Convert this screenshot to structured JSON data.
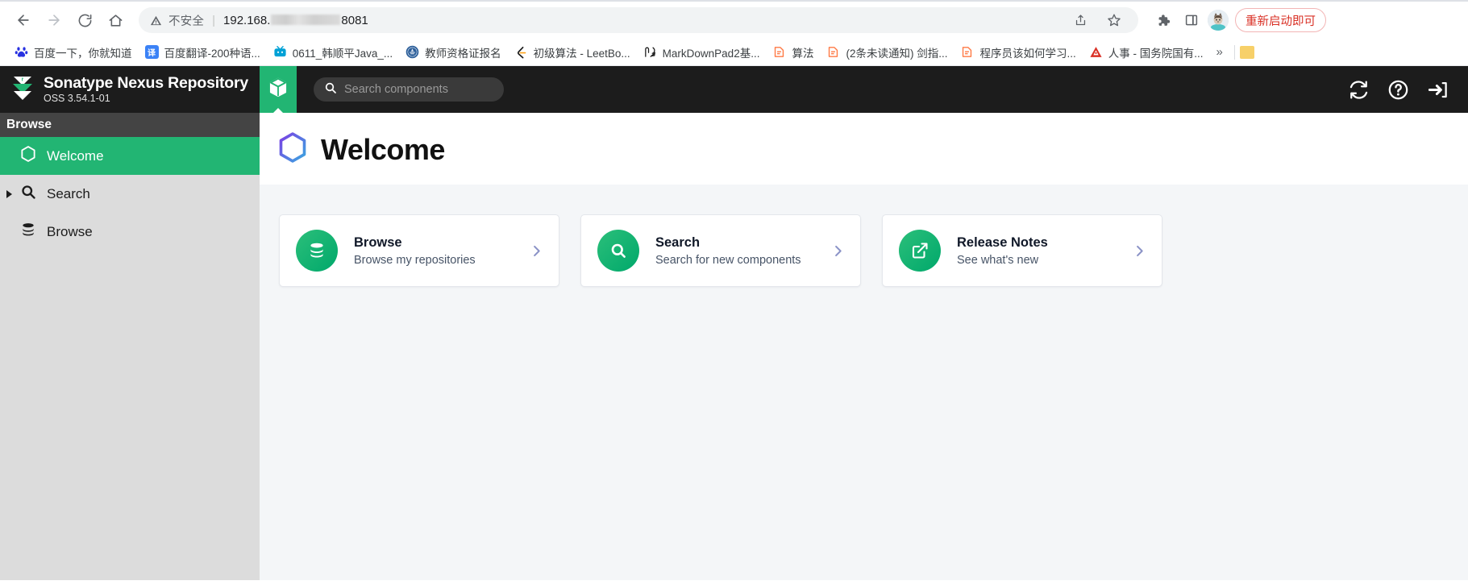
{
  "browser": {
    "nav": {
      "back": "back-arrow",
      "forward": "forward-arrow",
      "reload": "reload",
      "home": "home"
    },
    "omnibox": {
      "security_label": "不安全",
      "separator": "|",
      "url_prefix": "192.168.",
      "url_suffix": "8081",
      "share_icon": "share",
      "bookmark_icon": "star"
    },
    "toolbar_right": {
      "extensions_icon": "puzzle-piece",
      "sidepanel_icon": "side-panel",
      "profile_icon": "avatar",
      "restart_label": "重新启动即可"
    },
    "bookmarks": [
      {
        "label": "百度一下，你就知道",
        "icon": "baidu",
        "color": "#2932e1"
      },
      {
        "label": "百度翻译-200种语...",
        "icon": "translate",
        "color": "#3b82f6"
      },
      {
        "label": "0611_韩顺平Java_...",
        "icon": "bilibili",
        "color": "#00a1d6"
      },
      {
        "label": "教师资格证报名",
        "icon": "gov-seal",
        "color": "#2d5f9a"
      },
      {
        "label": "初级算法 - LeetBo...",
        "icon": "leetcode",
        "color": "#ffa116"
      },
      {
        "label": "MarkDownPad2基...",
        "icon": "markdownpad",
        "color": "#1c1c1c"
      },
      {
        "label": "算法",
        "icon": "yuque",
        "color": "#ff7a45"
      },
      {
        "label": "(2条未读通知) 剑指...",
        "icon": "yuque",
        "color": "#ff7a45"
      },
      {
        "label": "程序员该如何学习...",
        "icon": "yuque",
        "color": "#ff7a45"
      },
      {
        "label": "人事 - 国务院国有...",
        "icon": "sasac",
        "color": "#d93025"
      }
    ],
    "bookmarks_overflow": "»",
    "bookmarks_folder": "folder-icon"
  },
  "nexus": {
    "header": {
      "product_name": "Sonatype Nexus Repository",
      "version": "OSS 3.54.1-01",
      "logo_icon": "sonatype-chevron-logo",
      "active_tab_icon": "cube-icon",
      "search_placeholder": "Search components",
      "search_value": "",
      "search_icon": "search-icon",
      "icons": {
        "refresh": "refresh-icon",
        "help": "help-circle-icon",
        "sign_in": "sign-in-icon"
      }
    },
    "sidebar": {
      "section_title": "Browse",
      "items": [
        {
          "label": "Welcome",
          "icon": "hexagon-icon",
          "active": true,
          "expandable": false
        },
        {
          "label": "Search",
          "icon": "search-icon",
          "active": false,
          "expandable": true
        },
        {
          "label": "Browse",
          "icon": "database-icon",
          "active": false,
          "expandable": false
        }
      ]
    },
    "page": {
      "title": "Welcome",
      "title_icon": "hexagon-gradient-icon",
      "cards": [
        {
          "title": "Browse",
          "subtitle": "Browse my repositories",
          "icon": "database-icon",
          "chevron": "chevron-right-icon"
        },
        {
          "title": "Search",
          "subtitle": "Search for new components",
          "icon": "search-icon",
          "chevron": "chevron-right-icon"
        },
        {
          "title": "Release Notes",
          "subtitle": "See what's new",
          "icon": "external-link-icon",
          "chevron": "chevron-right-icon"
        }
      ]
    }
  },
  "colors": {
    "nexus_green": "#22b573",
    "header_dark": "#1c1c1c",
    "sidebar_grey": "#dcdcdc",
    "content_bg": "#f4f6f8",
    "accent_chevron": "#8b93c7"
  }
}
